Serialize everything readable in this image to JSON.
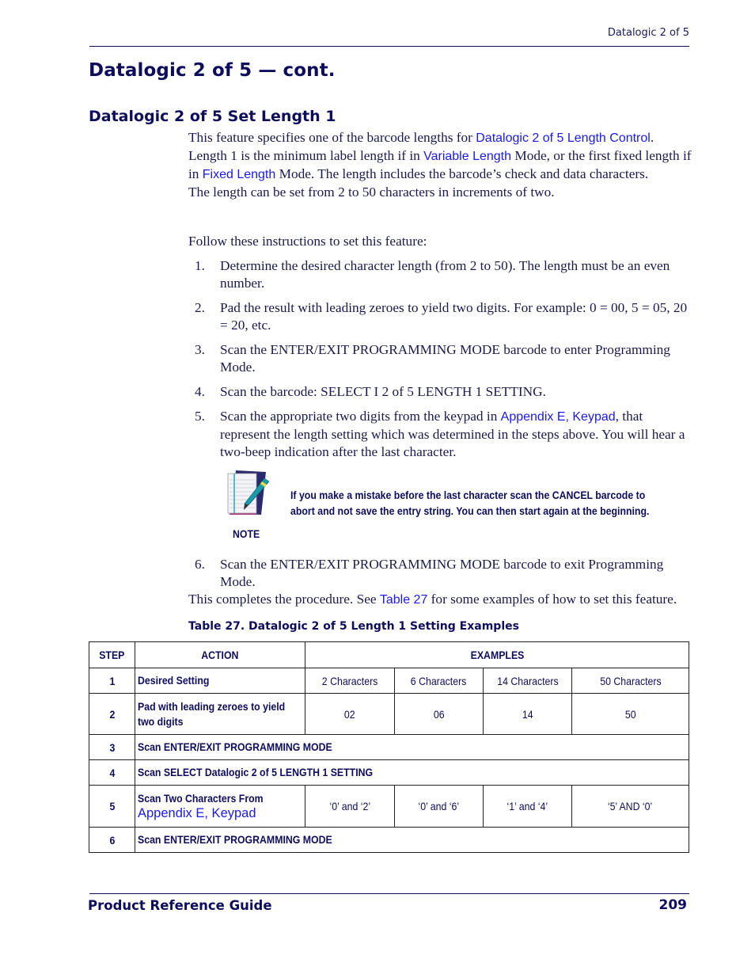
{
  "header": {
    "running_title": "Datalogic 2 of 5"
  },
  "page_title": "Datalogic 2 of 5 — cont.",
  "section": {
    "title": "Datalogic 2 of 5 Set Length 1",
    "intro": {
      "p1_a": "This feature specifies one of the barcode lengths for ",
      "p1_link": "Datalogic 2 of 5 Length Control",
      "p1_b": ". Length 1 is the minimum label length if in ",
      "p1_link2": "Variable Length",
      "p1_c": " Mode, or the first fixed length if in ",
      "p1_link3": "Fixed Length",
      "p1_d": " Mode. The length includes the barcode’s check and data characters.",
      "p2": "The length can be set from 2 to 50 characters in increments of two."
    },
    "follow": "Follow these instructions to set this feature:",
    "steps": [
      {
        "num": "1.",
        "text": "Determine the desired character length (from 2 to 50). The length must be an even number."
      },
      {
        "num": "2.",
        "text": "Pad the result with leading zeroes to yield two digits. For example: 0 = 00, 5 = 05, 20 = 20, etc."
      },
      {
        "num": "3.",
        "text": "Scan the ENTER/EXIT PROGRAMMING MODE barcode to enter Programming Mode."
      },
      {
        "num": "4.",
        "text": "Scan the barcode: SELECT I 2 of 5 LENGTH 1 SETTING."
      },
      {
        "num": "5.",
        "text_a": "Scan the appropriate two digits from the keypad in ",
        "link": "Appendix E, Keypad",
        "text_b": ", that represent the length setting which was determined in the steps above. You will hear a two-beep indication after the last character."
      },
      {
        "num": "6.",
        "text": "Scan the ENTER/EXIT PROGRAMMING MODE barcode to exit Programming Mode."
      }
    ],
    "note": {
      "icon": "notepad-pen-icon",
      "label": "NOTE",
      "text": "If you make a mistake before the last character scan the CANCEL barcode to abort and not save the entry string. You can then start again at the beginning."
    },
    "completion": {
      "a": "This completes the procedure. See ",
      "link": "Table 27",
      "b": " for some examples of how to set this feature."
    }
  },
  "table": {
    "caption": "Table 27. Datalogic 2 of 5 Length 1 Setting Examples",
    "headers": {
      "step": "STEP",
      "action": "ACTION",
      "examples": "EXAMPLES"
    },
    "rows": [
      {
        "step": "1",
        "action": "Desired Setting",
        "examples": [
          "2 Characters",
          "6 Characters",
          "14 Characters",
          "50 Characters"
        ]
      },
      {
        "step": "2",
        "action": "Pad with leading zeroes to yield two digits",
        "examples": [
          "02",
          "06",
          "14",
          "50"
        ]
      },
      {
        "step": "3",
        "action": "Scan ENTER/EXIT PROGRAMMING MODE"
      },
      {
        "step": "4",
        "action": "Scan SELECT Datalogic 2 of 5 LENGTH 1 SETTING"
      },
      {
        "step": "5",
        "action": "Scan Two Characters From",
        "action_link": "Appendix E, Keypad",
        "examples": [
          "‘0’ and ‘2’",
          "‘0’ and ‘6’",
          "‘1’ and ‘4’",
          "‘5’ AND ‘0’"
        ]
      },
      {
        "step": "6",
        "action": "Scan ENTER/EXIT PROGRAMMING MODE"
      }
    ]
  },
  "footer": {
    "title": "Product Reference Guide",
    "page_number": "209"
  },
  "colors": {
    "heading": "#0d0d5c",
    "link": "#1a1aee",
    "body_text": "#1a1a4e"
  }
}
